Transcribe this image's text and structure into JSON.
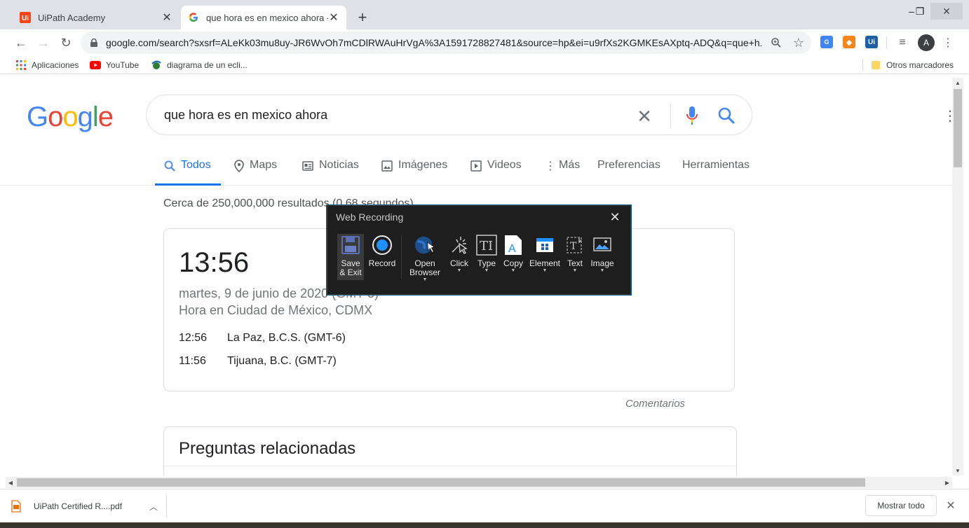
{
  "browser": {
    "tabs": [
      {
        "title": "UiPath Academy",
        "active": false
      },
      {
        "title": "que hora es en mexico ahora - Bu",
        "active": true
      }
    ],
    "url": "google.com/search?sxsrf=ALeKk03mu8uy-JR6WvOh7mCDlRWAuHrVgA%3A1591728827481&source=hp&ei=u9rfXs2KGMKEsAXptq-ADQ&q=que+h...",
    "profile_initial": "A",
    "bookmarks": [
      {
        "label": "Aplicaciones"
      },
      {
        "label": "YouTube"
      },
      {
        "label": "diagrama de un ecli..."
      }
    ],
    "other_bookmarks": "Otros marcadores",
    "extensions": {
      "uipath_label": "Ui"
    }
  },
  "google": {
    "logo_letters": [
      "G",
      "o",
      "o",
      "g",
      "l",
      "e"
    ],
    "logo_colors": [
      "#4285f4",
      "#ea4335",
      "#fbbc05",
      "#4285f4",
      "#34a853",
      "#ea4335"
    ],
    "query": "que hora es en mexico ahora",
    "nav": [
      {
        "label": "Todos",
        "icon": "search-icon"
      },
      {
        "label": "Maps",
        "icon": "map-pin-icon"
      },
      {
        "label": "Noticias",
        "icon": "news-icon"
      },
      {
        "label": "Imágenes",
        "icon": "image-icon"
      },
      {
        "label": "Videos",
        "icon": "video-icon"
      },
      {
        "label": "Más",
        "icon": "more-dots-icon"
      },
      {
        "label": "Preferencias"
      },
      {
        "label": "Herramientas"
      }
    ],
    "result_stats": "Cerca de 250,000,000 resultados (0.68 segundos)",
    "clock_card": {
      "time": "13:56",
      "date": "martes, 9 de junio de 2020 (GMT-5)",
      "place": "Hora en Ciudad de México, CDMX",
      "zones": [
        {
          "time": "12:56",
          "place": "La Paz, B.C.S. (GMT-6)"
        },
        {
          "time": "11:56",
          "place": "Tijuana, B.C. (GMT-7)"
        }
      ]
    },
    "feedback": "Comentarios",
    "related_heading": "Preguntas relacionadas"
  },
  "recorder": {
    "title": "Web Recording",
    "tools": [
      {
        "label": "Save\n& Exit",
        "icon": "save-icon"
      },
      {
        "label": "Record",
        "icon": "record-icon"
      },
      {
        "label": "Open\nBrowser",
        "icon": "globe-icon"
      },
      {
        "label": "Click",
        "icon": "click-icon"
      },
      {
        "label": "Type",
        "icon": "type-icon"
      },
      {
        "label": "Copy",
        "icon": "copy-icon"
      },
      {
        "label": "Element",
        "icon": "element-icon"
      },
      {
        "label": "Text",
        "icon": "text-icon"
      },
      {
        "label": "Image",
        "icon": "image-icon"
      }
    ]
  },
  "downloads": {
    "file": "UiPath Certified R....pdf",
    "show_all": "Mostrar todo"
  }
}
